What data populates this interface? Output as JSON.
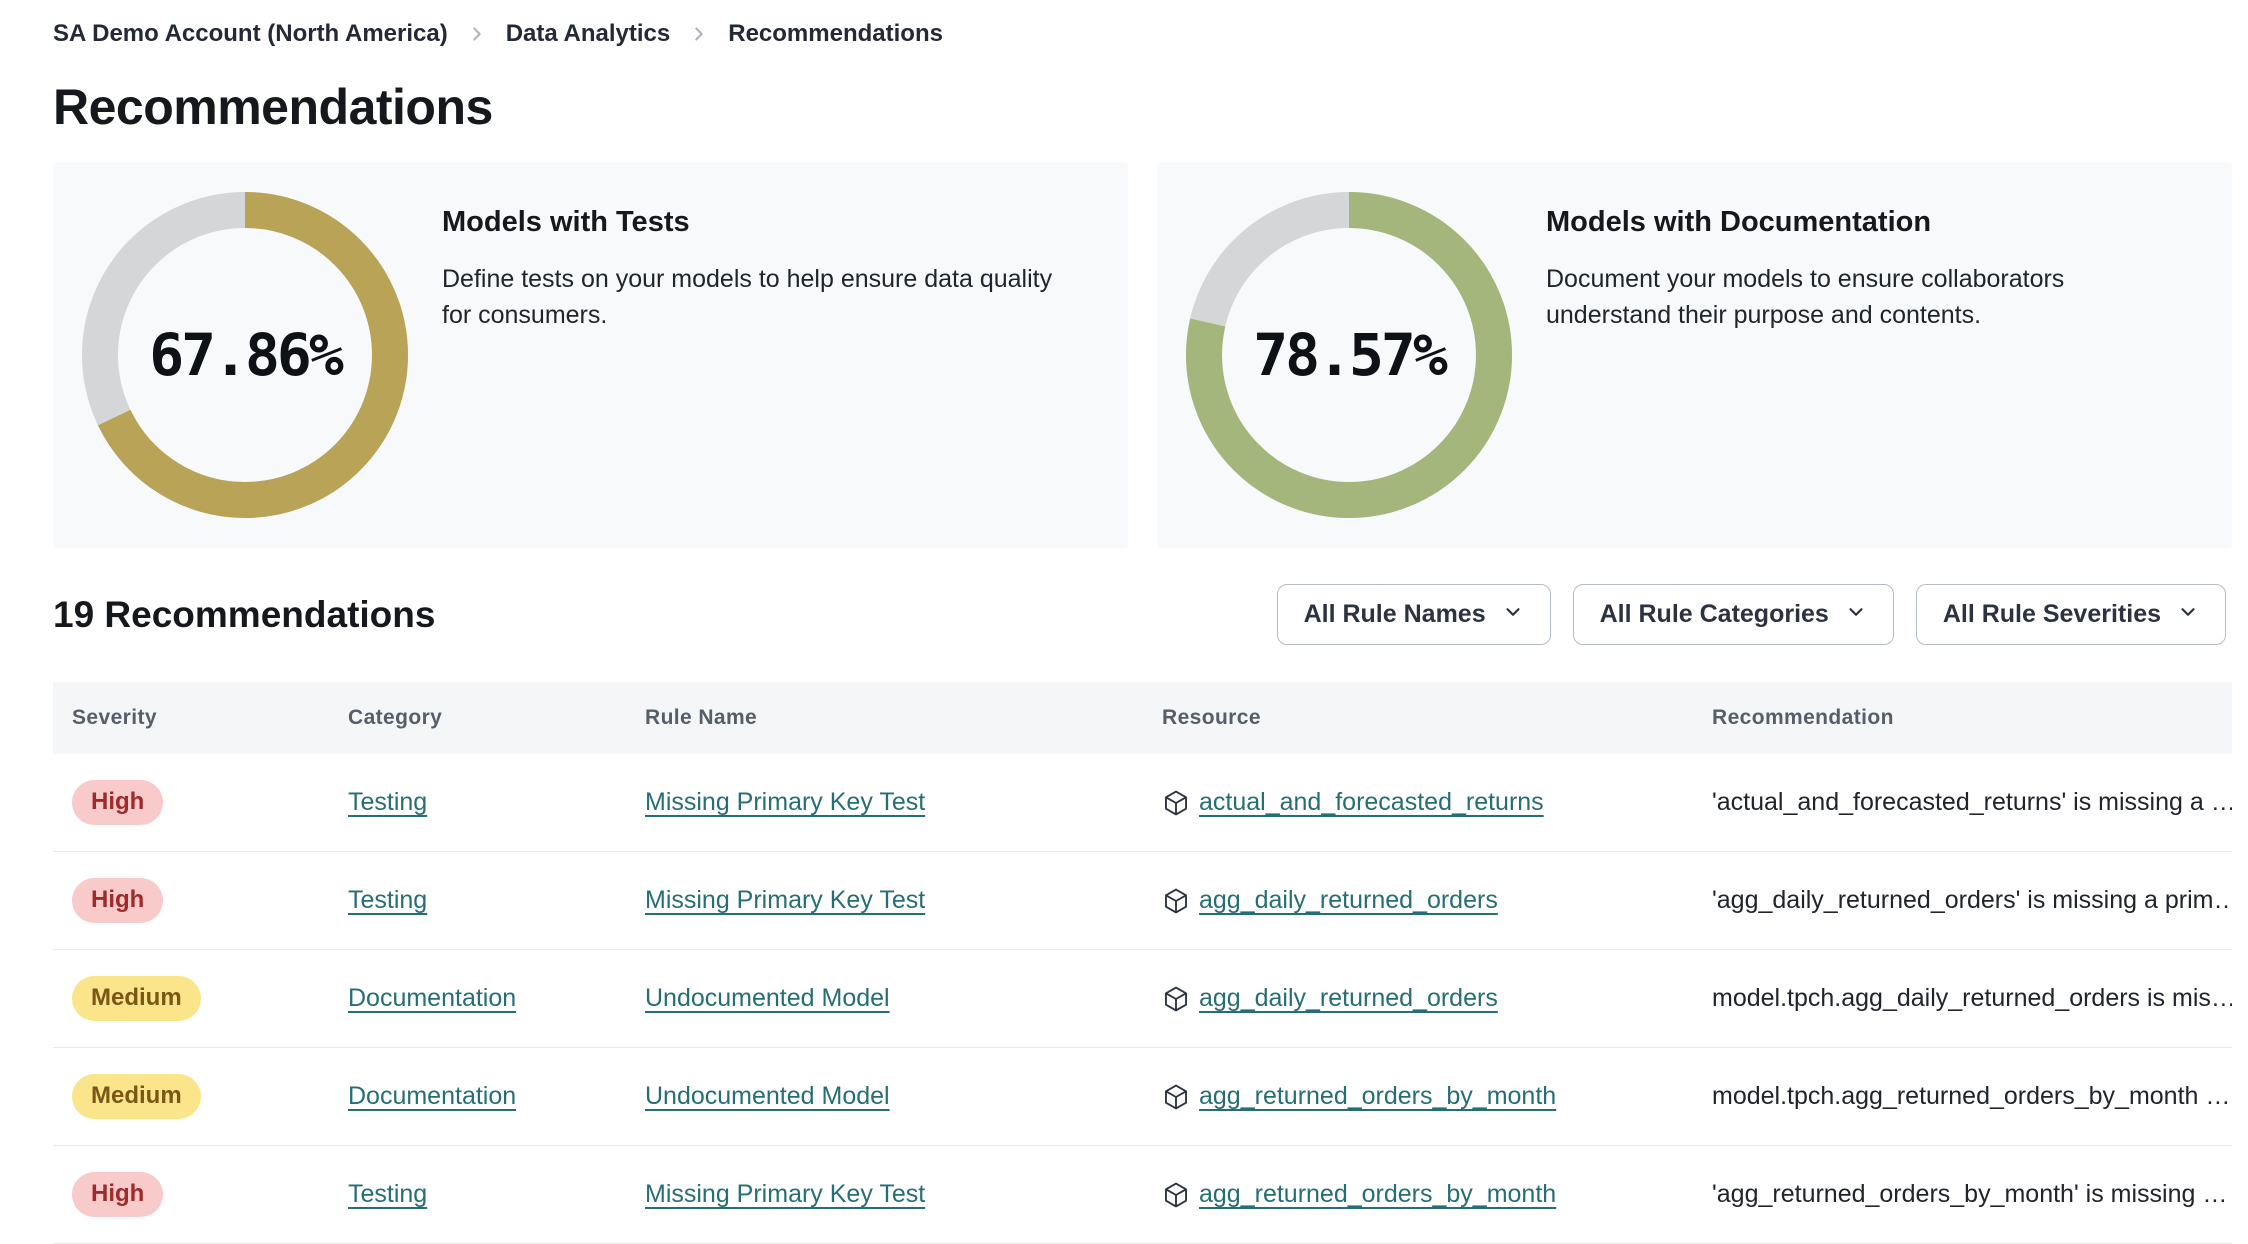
{
  "breadcrumb": {
    "items": [
      {
        "label": "SA Demo Account (North America)"
      },
      {
        "label": "Data Analytics"
      },
      {
        "label": "Recommendations"
      }
    ]
  },
  "page": {
    "title": "Recommendations"
  },
  "cards": [
    {
      "title": "Models with Tests",
      "description": "Define tests on your models to help ensure data quality for consumers.",
      "percent": "67.86%",
      "value": 67.86,
      "color": "#b8a357"
    },
    {
      "title": "Models with Documentation",
      "description": "Document your models to ensure collaborators understand their purpose and contents.",
      "percent": "78.57%",
      "value": 78.57,
      "color": "#a4b67b"
    }
  ],
  "list_header": {
    "count_label": "19 Recommendations"
  },
  "filters": [
    {
      "label": "All Rule Names"
    },
    {
      "label": "All Rule Categories"
    },
    {
      "label": "All Rule Severities"
    }
  ],
  "icons": {
    "breadcrumb_separator": "chevron-right-icon",
    "filter_dropdown": "chevron-down-icon",
    "resource": "package-cube-icon"
  },
  "table": {
    "columns": {
      "severity": "Severity",
      "category": "Category",
      "rule_name": "Rule Name",
      "resource": "Resource",
      "recommendation": "Recommendation"
    },
    "rows": [
      {
        "severity": "High",
        "category": "Testing",
        "rule_name": "Missing Primary Key Test",
        "resource": "actual_and_forecasted_returns",
        "recommendation": "'actual_and_forecasted_returns' is missing a …"
      },
      {
        "severity": "High",
        "category": "Testing",
        "rule_name": "Missing Primary Key Test",
        "resource": "agg_daily_returned_orders",
        "recommendation": "'agg_daily_returned_orders' is missing a prim…"
      },
      {
        "severity": "Medium",
        "category": "Documentation",
        "rule_name": "Undocumented Model",
        "resource": "agg_daily_returned_orders",
        "recommendation": "model.tpch.agg_daily_returned_orders is mis…"
      },
      {
        "severity": "Medium",
        "category": "Documentation",
        "rule_name": "Undocumented Model",
        "resource": "agg_returned_orders_by_month",
        "recommendation": "model.tpch.agg_returned_orders_by_month …"
      },
      {
        "severity": "High",
        "category": "Testing",
        "rule_name": "Missing Primary Key Test",
        "resource": "agg_returned_orders_by_month",
        "recommendation": "'agg_returned_orders_by_month' is missing …"
      }
    ]
  },
  "colors": {
    "accent_gold": "#b8a357",
    "accent_green": "#a4b67b",
    "donut_track": "#d5d6d8",
    "link_teal": "#266e75",
    "badge_high_bg": "#f9caca",
    "badge_high_text": "#9e2b2b",
    "badge_medium_bg": "#fbe58b",
    "badge_medium_text": "#7b5617",
    "card_bg": "#f8f9fa",
    "table_header_bg": "#f5f6f8"
  }
}
